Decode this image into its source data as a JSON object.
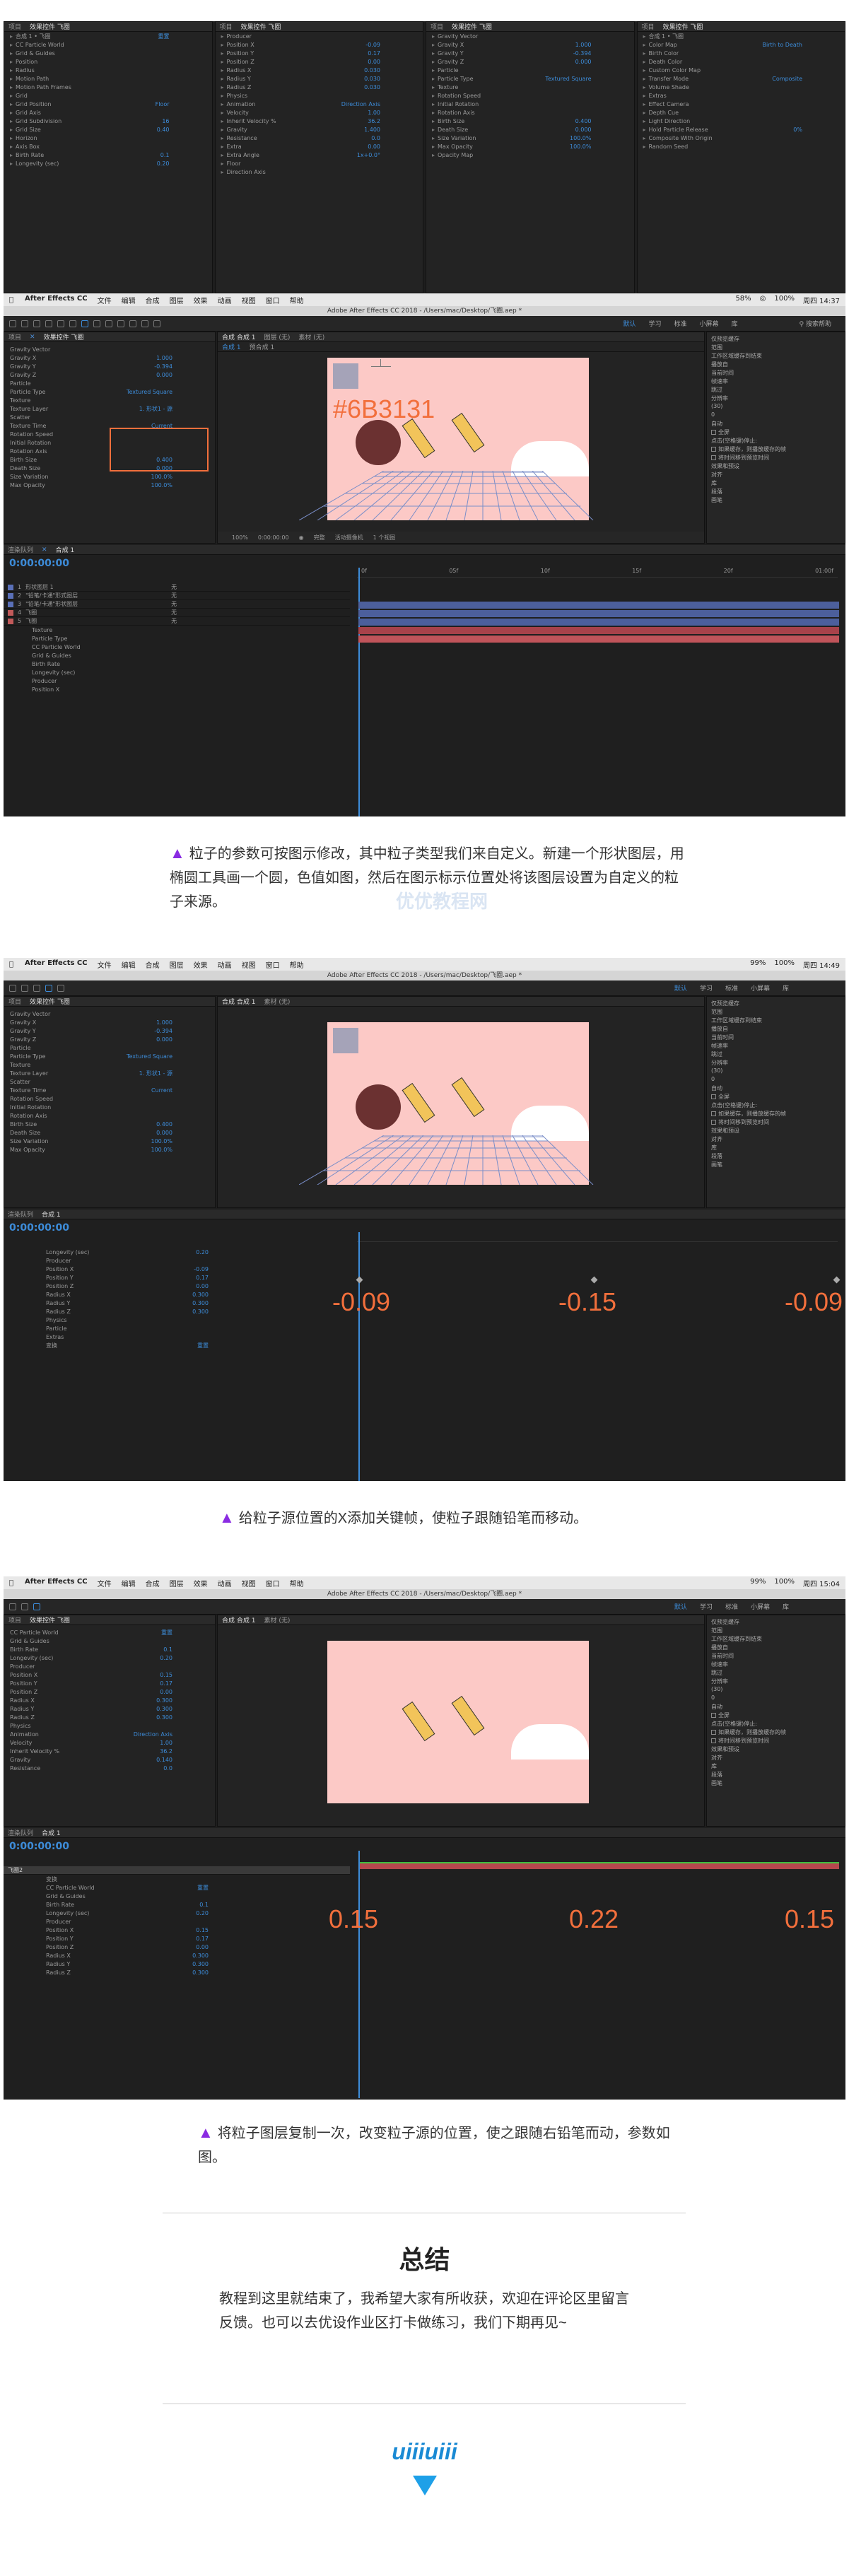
{
  "top_strip": {
    "panels": [
      {
        "tab": "项目",
        "active": "效果控件 飞圈",
        "rows": [
          "合成 1 • 飞圈",
          "CC Particle World",
          "Grid & Guides",
          "Position",
          "Radius",
          "Motion Path",
          "Motion Path Frames",
          "Grid",
          "Grid Position",
          "Grid Axis",
          "Grid Subdivision",
          "Grid Size",
          "Horizon",
          "Axis Box",
          "Birth Rate",
          "Longevity (sec)"
        ],
        "values": [
          "重置",
          "",
          "",
          "",
          "",
          "",
          "",
          "",
          "Floor",
          "",
          "16",
          "0.40",
          "",
          "",
          "0.1",
          "0.20"
        ]
      },
      {
        "tab": "项目",
        "active": "效果控件 飞圈",
        "rows": [
          "Producer",
          "Position X",
          "Position Y",
          "Position Z",
          "Radius X",
          "Radius Y",
          "Radius Z",
          "Physics",
          "Animation",
          "Velocity",
          "Inherit Velocity %",
          "Gravity",
          "Resistance",
          "Extra",
          "Extra Angle",
          "Floor",
          "Direction Axis"
        ],
        "values": [
          "",
          "-0.09",
          "0.17",
          "0.00",
          "0.030",
          "0.030",
          "0.030",
          "",
          "Direction Axis",
          "1.00",
          "36.2",
          "1.400",
          "0.0",
          "0.00",
          "1x+0.0°",
          "",
          ""
        ]
      },
      {
        "tab": "项目",
        "active": "效果控件 飞圈",
        "rows": [
          "Gravity Vector",
          "Gravity X",
          "Gravity Y",
          "Gravity Z",
          "Particle",
          "Particle Type",
          "Texture",
          "Rotation Speed",
          "Initial Rotation",
          "Rotation Axis",
          "Birth Size",
          "Death Size",
          "Size Variation",
          "Max Opacity",
          "Opacity Map"
        ],
        "values": [
          "",
          "1.000",
          "-0.394",
          "0.000",
          "",
          "Textured Square",
          "",
          "",
          "",
          "",
          "0.400",
          "0.000",
          "100.0%",
          "100.0%",
          ""
        ]
      },
      {
        "tab": "项目",
        "active": "效果控件 飞圈",
        "rows": [
          "合成 1 • 飞圈",
          "Color Map",
          "Birth Color",
          "Death Color",
          "Custom Color Map",
          "Transfer Mode",
          "Volume Shade",
          "Extras",
          "Effect Camera",
          "Depth Cue",
          "Light Direction",
          "Hold Particle Release",
          "Composite With Origin",
          "Random Seed"
        ],
        "values": [
          "",
          "Birth to Death",
          "",
          "",
          "",
          "Composite",
          "",
          "",
          "",
          "",
          "",
          "0%",
          "",
          ""
        ]
      }
    ]
  },
  "mac_menu": [
    "After Effects CC",
    "文件",
    "编辑",
    "合成",
    "图层",
    "效果",
    "动画",
    "视图",
    "窗口",
    "帮助"
  ],
  "screens": [
    {
      "window_title": "Adobe After Effects CC 2018 - /Users/mac/Desktop/飞圈.aep *",
      "status": [
        "58%",
        "100%",
        "周四 14:37"
      ],
      "workspaces": [
        "默认",
        "学习",
        "标准",
        "小屏幕",
        "库"
      ],
      "search": "搜索帮助",
      "tab_effects": "效果控件 飞圈",
      "comp_tab": "合成 合成 1",
      "sub_tabs": [
        "合成 1",
        "预合成 1"
      ],
      "footage": "素材 (无)",
      "layer": "图层 (无)",
      "timecode": "0:00:00:00",
      "zoom": "100%",
      "quality": "完整",
      "camera": "活动摄像机",
      "views": "1 个视图",
      "effects": [
        "Gravity Vector",
        "Gravity X",
        "Gravity Y",
        "Gravity Z",
        "Particle",
        "Particle Type",
        "Texture",
        "Texture Layer",
        "Scatter",
        "Texture Time",
        "Rotation Speed",
        "Initial Rotation",
        "Rotation Axis",
        "Birth Size",
        "Death Size",
        "Size Variation",
        "Max Opacity"
      ],
      "effect_values": [
        "",
        "1.000",
        "-0.394",
        "0.000",
        "",
        "Textured Square",
        "",
        "1. 形状1 - 源",
        "",
        "Current",
        "",
        "",
        "",
        "0.400",
        "0.000",
        "100.0%",
        "100.0%"
      ],
      "color_note": "#6B3131",
      "layers": [
        {
          "num": "1",
          "name": "形状图层 1",
          "mode": "无"
        },
        {
          "num": "2",
          "name": "\"铅笔/卡通\"形式图层",
          "mode": "无"
        },
        {
          "num": "3",
          "name": "\"铅笔/卡通\"形状图层",
          "mode": "无"
        },
        {
          "num": "4",
          "name": "飞圈",
          "mode": "无"
        },
        {
          "num": "5",
          "name": "飞圈",
          "mode": "无"
        }
      ],
      "sub_rows": [
        "Texture",
        "Particle Type",
        "CC Particle World",
        "Grid & Guides",
        "Birth Rate",
        "Longevity (sec)",
        "Producer",
        "Position X"
      ],
      "ruler": [
        "0f",
        "05f",
        "10f",
        "15f",
        "20f",
        "01:00f"
      ],
      "right_panel": [
        "仅预览缓存",
        "范围",
        "工作区域缓存到结束",
        "播放自",
        "当前时间",
        "帧速率",
        "跳过",
        "分辨率",
        "(30)",
        "0",
        "自动",
        "全屏",
        "点击(空格键)停止:",
        "如果缓存，则播放缓存的帧",
        "将时间移到预览时间",
        "效果和预设",
        "对齐",
        "库",
        "段落",
        "画笔"
      ]
    },
    {
      "window_title": "Adobe After Effects CC 2018 - /Users/mac/Desktop/飞圈.aep *",
      "status": [
        "99%",
        "100%",
        "周四 14:49"
      ],
      "timecode": "0:00:00:00",
      "effect_values": [
        "",
        "1.000",
        "-0.394",
        "0.000",
        "",
        "Textured Square",
        "",
        "1. 形状1 - 源",
        "",
        "Current",
        "",
        "",
        "",
        "0.400",
        "0.000",
        "100.0%",
        "100.0%"
      ],
      "keyframes": [
        "-0.09",
        "-0.15",
        "-0.09"
      ],
      "tl_rows": [
        "Longevity (sec)",
        "Producer",
        "Position X",
        "Position Y",
        "Position Z",
        "Radius X",
        "Radius Y",
        "Radius Z",
        "Physics",
        "Particle",
        "Extras",
        "变换"
      ],
      "tl_values": [
        "0.20",
        "",
        "-0.09",
        "0.17",
        "0.00",
        "0.300",
        "0.300",
        "0.300",
        "",
        "",
        "",
        "重置"
      ]
    },
    {
      "window_title": "Adobe After Effects CC 2018 - /Users/mac/Desktop/飞圈.aep *",
      "status": [
        "99%",
        "100%",
        "周四 15:04"
      ],
      "timecode": "0:00:00:00",
      "effects": [
        "CC Particle World",
        "Grid & Guides",
        "Birth Rate",
        "Longevity (sec)",
        "Producer",
        "Position X",
        "Position Y",
        "Position Z",
        "Radius X",
        "Radius Y",
        "Radius Z",
        "Physics",
        "Animation",
        "Velocity",
        "Inherit Velocity %",
        "Gravity",
        "Resistance"
      ],
      "effect_values": [
        "重置",
        "",
        "0.1",
        "0.20",
        "",
        "0.15",
        "0.17",
        "0.00",
        "0.300",
        "0.300",
        "0.300",
        "",
        "Direction Axis",
        "1.00",
        "36.2",
        "0.140",
        "0.0"
      ],
      "keyframes": [
        "0.15",
        "0.22",
        "0.15"
      ],
      "tl_rows": [
        "变换",
        "CC Particle World",
        "Grid & Guides",
        "Birth Rate",
        "Longevity (sec)",
        "Producer",
        "Position X",
        "Position Y",
        "Position Z",
        "Radius X",
        "Radius Y",
        "Radius Z"
      ],
      "tl_values": [
        "",
        "重置",
        "",
        "0.1",
        "0.20",
        "",
        "0.15",
        "0.17",
        "0.00",
        "0.300",
        "0.300",
        "0.300"
      ],
      "layer_name": "飞圈2"
    }
  ],
  "captions": [
    "粒子的参数可按图示修改，其中粒子类型我们来自定义。新建一个形状图层，用椭圆工具画一个圆，色值如图，然后在图示标示位置处将该图层设置为自定义的粒子来源。",
    "给粒子源位置的X添加关键帧，使粒子跟随铅笔而移动。",
    "将粒子图层复制一次，改变粒子源的位置，使之跟随右铅笔而动，参数如图。"
  ],
  "summary": {
    "title": "总结",
    "body": "教程到这里就结束了，我希望大家有所收获，欢迎在评论区里留言反馈。也可以去优设作业区打卡做练习，我们下期再见~"
  },
  "footer_logo": "uiiiuiii",
  "watermark": "优优教程网",
  "colors": {
    "accent": "#3d8cd9",
    "annotation": "#f26f3c",
    "caption_triangle": "#8a2be2",
    "canvas": "#fcc9c6",
    "circle": "#6B3131",
    "footer_logo": "#1a8ad4"
  }
}
